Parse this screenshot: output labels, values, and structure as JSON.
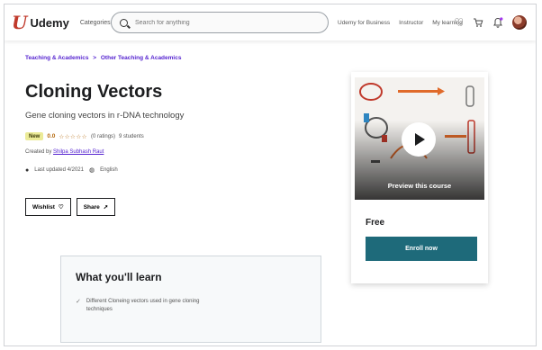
{
  "header": {
    "logo_text": "Udemy",
    "categories": "Categories",
    "search_placeholder": "Search for anything",
    "links": [
      "Udemy for Business",
      "Instructor",
      "My learning"
    ]
  },
  "breadcrumb": [
    "Teaching & Academics",
    ">",
    "Other Teaching & Academics"
  ],
  "course": {
    "title": "Cloning Vectors",
    "subtitle": "Gene cloning vectors in r-DNA technology",
    "badge": "New",
    "rating": "0.0",
    "stars": "☆☆☆☆☆",
    "ratings_count": "(0 ratings)",
    "students": "9 students",
    "created_by_label": "Created by",
    "instructor": "Shilpa Subhash Raut",
    "last_updated": "Last updated 4/2021",
    "language": "English"
  },
  "buttons": {
    "wishlist": "Wishlist",
    "share": "Share"
  },
  "learn": {
    "title": "What you'll learn",
    "items": [
      "Different Cloneing vectors used in gene cloning techniques"
    ]
  },
  "card": {
    "preview_label": "Preview this course",
    "price": "Free",
    "enroll": "Enroll now"
  },
  "colors": {
    "brand": "#a435f0",
    "enroll": "#1e6a7a",
    "link": "#5624d0",
    "rating": "#b4690e"
  }
}
